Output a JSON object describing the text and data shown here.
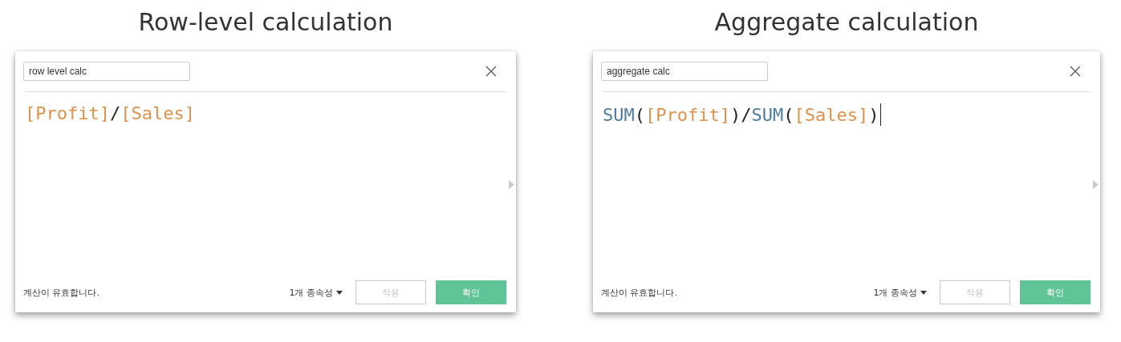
{
  "panels": [
    {
      "title": "Row-level calculation",
      "dialog": {
        "name": "row level calc",
        "cursor": false,
        "formula": [
          {
            "kind": "field",
            "text": "[Profit]"
          },
          {
            "kind": "operator",
            "text": "/"
          },
          {
            "kind": "field",
            "text": "[Sales]"
          }
        ],
        "status": "계산이 유효합니다.",
        "dependencies": "1개 종속성",
        "apply": {
          "label": "적용",
          "disabled": true
        },
        "ok": {
          "label": "확인",
          "disabled": false
        }
      }
    },
    {
      "title": "Aggregate calculation",
      "dialog": {
        "name": "aggregate calc",
        "cursor": true,
        "formula": [
          {
            "kind": "function",
            "text": "SUM"
          },
          {
            "kind": "operator",
            "text": "("
          },
          {
            "kind": "field",
            "text": "[Profit]"
          },
          {
            "kind": "operator",
            "text": ")/"
          },
          {
            "kind": "function",
            "text": "SUM"
          },
          {
            "kind": "operator",
            "text": "("
          },
          {
            "kind": "field",
            "text": "[Sales]"
          },
          {
            "kind": "operator",
            "text": ")"
          }
        ],
        "status": "계산이 유효합니다.",
        "dependencies": "1개 종속성",
        "apply": {
          "label": "적용",
          "disabled": true
        },
        "ok": {
          "label": "확인",
          "disabled": false
        }
      }
    }
  ]
}
